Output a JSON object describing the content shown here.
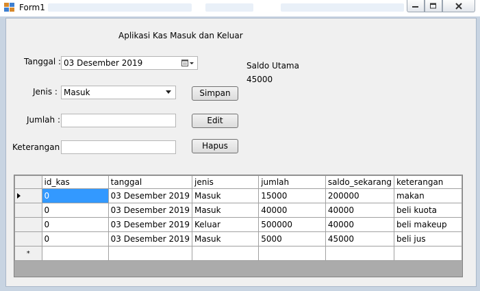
{
  "window": {
    "title": "Form1",
    "icon": "form-icon"
  },
  "form": {
    "heading": "Aplikasi Kas Masuk dan Keluar",
    "tanggal_label": "Tanggal :",
    "tanggal_value": "03 Desember 2019",
    "jenis_label": "Jenis :",
    "jenis_value": "Masuk",
    "jumlah_label": "Jumlah :",
    "jumlah_value": "",
    "keterangan_label": "Keterangan :",
    "keterangan_value": "",
    "simpan_label": "Simpan",
    "edit_label": "Edit",
    "hapus_label": "Hapus",
    "saldo_label": "Saldo Utama",
    "saldo_value": "45000"
  },
  "grid": {
    "columns": [
      "id_kas",
      "tanggal",
      "jenis",
      "jumlah",
      "saldo_sekarang",
      "keterangan"
    ],
    "rows": [
      [
        "0",
        "03 Desember 2019",
        "Masuk",
        "15000",
        "200000",
        "makan"
      ],
      [
        "0",
        "03 Desember 2019",
        "Masuk",
        "40000",
        "40000",
        "beli kuota"
      ],
      [
        "0",
        "03 Desember 2019",
        "Keluar",
        "500000",
        "40000",
        "beli makeup"
      ],
      [
        "0",
        "03 Desember 2019",
        "Masuk",
        "5000",
        "45000",
        "beli jus"
      ]
    ],
    "new_row_marker": "*"
  }
}
